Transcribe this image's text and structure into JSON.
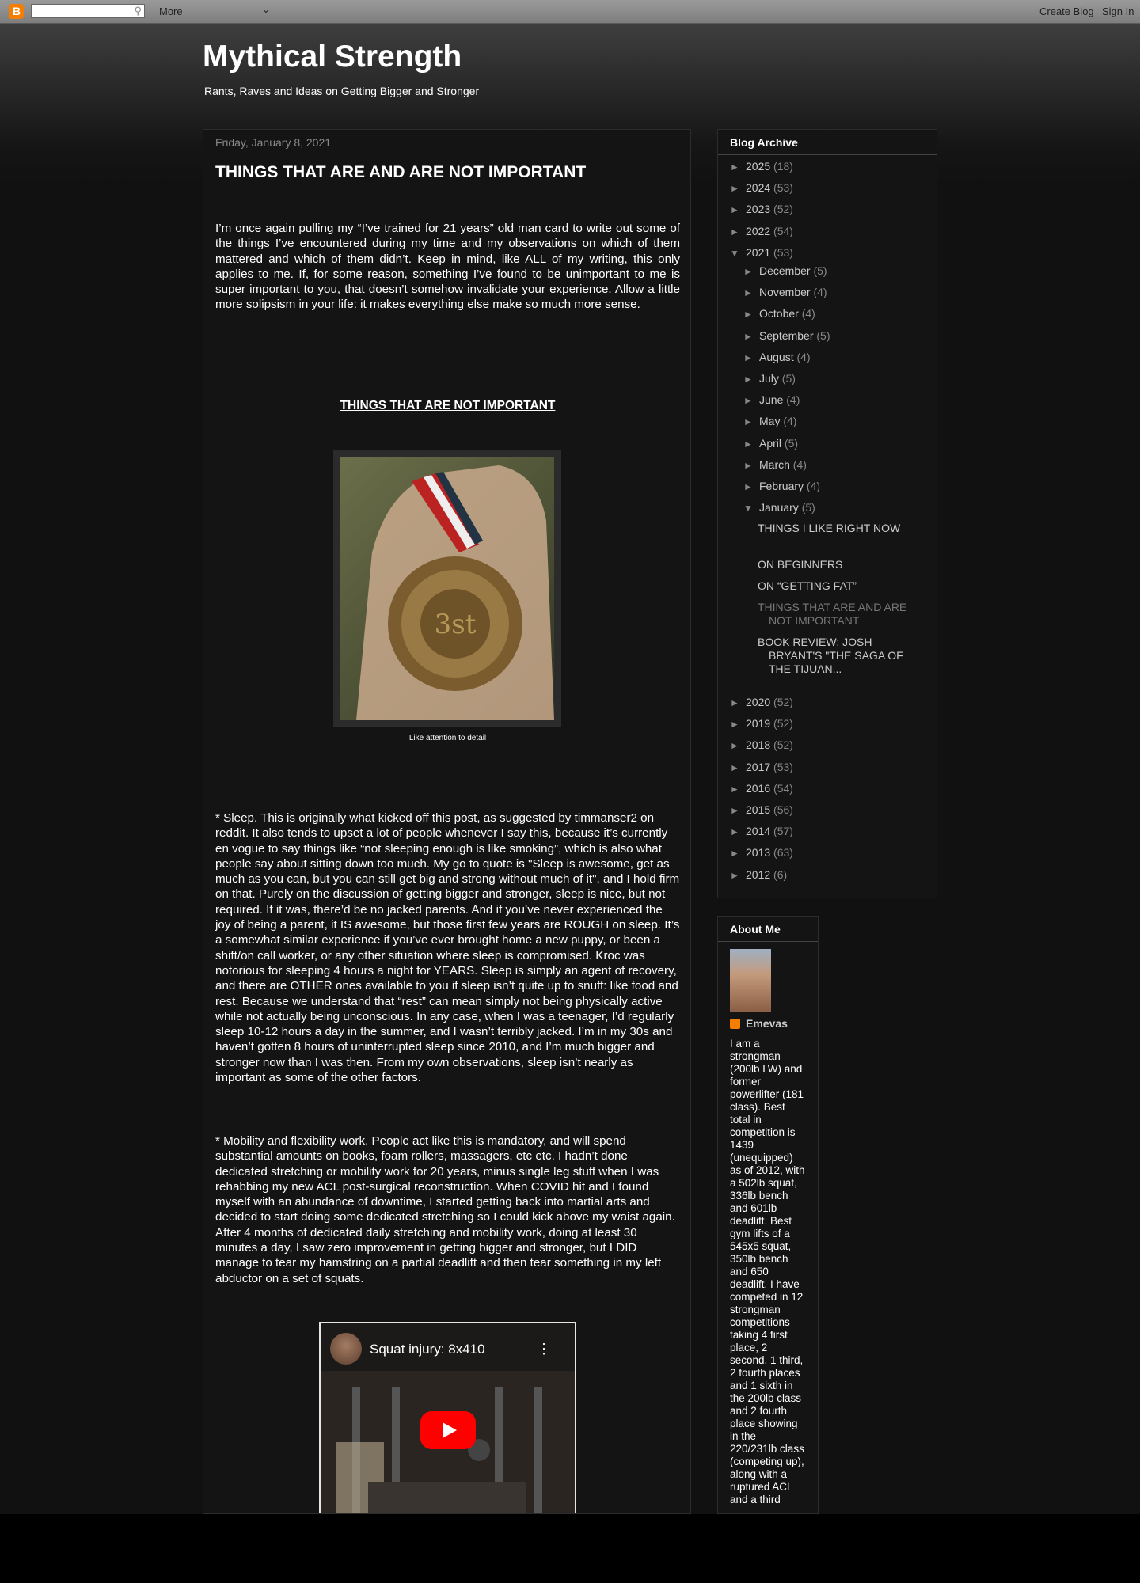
{
  "navbar": {
    "more_label": "More",
    "create_blog": "Create Blog",
    "sign_in": "Sign In"
  },
  "blog": {
    "title": "Mythical Strength",
    "description": "Rants, Raves and Ideas on Getting Bigger and Stronger"
  },
  "post": {
    "date": "Friday, January 8, 2021",
    "title": "THINGS THAT ARE AND ARE NOT IMPORTANT",
    "intro": "I’m once again pulling my “I’ve trained for 21 years” old man card to write out some of the things I’ve encountered during my time and my observations on which of them mattered and which of them didn’t.  Keep in mind, like ALL of my writing, this only applies to me.  If, for some reason, something I’ve found to be unimportant to me is super important to you, that doesn’t somehow invalidate your experience.  Allow a little more solipsism in your life: it makes everything else make so much more sense.",
    "section_heading": "THINGS THAT ARE NOT IMPORTANT",
    "image_caption": "Like attention to detail",
    "sleep": "* Sleep.  This is originally what kicked off this post, as suggested by timmanser2 on reddit.  It also tends to upset a lot of people whenever I say this, because it’s currently en vogue to say things like “not sleeping enough is like smoking”, which is also what people say about sitting down too much.  My go to quote is \"Sleep is awesome, get as much as you can, but you can still get big and strong without much of it\", and I hold firm on that.  Purely on the discussion of getting bigger and stronger, sleep is nice, but not required.  If it was, there’d be no jacked parents.  And if you’ve never experienced the joy of being a parent, it IS awesome, but those first few years are ROUGH on sleep.  It’s a somewhat similar experience if you’ve ever brought home a new puppy, or been a shift/on call worker, or any other situation where sleep is compromised.  Kroc was notorious for sleeping 4 hours a night for YEARS.  Sleep is simply an agent of recovery, and there are OTHER ones available to you if sleep isn’t quite up to snuff: like food and rest.  Because we understand that “rest” can mean simply not being physically active while not actually being unconscious.  In any case, when I was a teenager, I’d regularly sleep 10-12 hours a day in the summer, and I wasn’t terribly jacked.  I’m in my 30s and haven’t gotten 8 hours of uninterrupted sleep since 2010, and I’m much bigger and stronger now than I was then.  From my own observations, sleep isn’t nearly as important as some of the other factors.",
    "mobility": "* Mobility and flexibility work.  People act like this is mandatory, and will spend substantial amounts on books, foam rollers, massagers, etc etc.  I hadn’t done dedicated stretching or mobility work for 20 years, minus single leg stuff when I was rehabbing my new ACL post-surgical reconstruction.  When COVID hit and I found myself with an abundance of downtime, I started getting back into martial arts and decided to start doing some dedicated stretching so I could kick above my waist again.  After 4 months of dedicated daily stretching and mobility work, doing at least 30 minutes a day, I saw zero improvement in getting bigger and stronger, but I DID manage to tear my hamstring on a partial deadlift and then tear something in my left abductor on a set of squats.",
    "video_title": "Squat injury: 8x410"
  },
  "archive": {
    "title": "Blog Archive",
    "years_top": [
      {
        "toggle": "►",
        "year": "2025",
        "count": "(18)"
      },
      {
        "toggle": "►",
        "year": "2024",
        "count": "(53)"
      },
      {
        "toggle": "►",
        "year": "2023",
        "count": "(52)"
      },
      {
        "toggle": "►",
        "year": "2022",
        "count": "(54)"
      },
      {
        "toggle": "▼",
        "year": "2021",
        "count": "(53)"
      }
    ],
    "months": [
      {
        "toggle": "►",
        "month": "December",
        "count": "(5)"
      },
      {
        "toggle": "►",
        "month": "November",
        "count": "(4)"
      },
      {
        "toggle": "►",
        "month": "October",
        "count": "(4)"
      },
      {
        "toggle": "►",
        "month": "September",
        "count": "(5)"
      },
      {
        "toggle": "►",
        "month": "August",
        "count": "(4)"
      },
      {
        "toggle": "►",
        "month": "July",
        "count": "(5)"
      },
      {
        "toggle": "►",
        "month": "June",
        "count": "(4)"
      },
      {
        "toggle": "►",
        "month": "May",
        "count": "(4)"
      },
      {
        "toggle": "►",
        "month": "April",
        "count": "(5)"
      },
      {
        "toggle": "►",
        "month": "March",
        "count": "(4)"
      },
      {
        "toggle": "►",
        "month": "February",
        "count": "(4)"
      },
      {
        "toggle": "▼",
        "month": "January",
        "count": "(5)"
      }
    ],
    "january_posts": [
      "THINGS I LIKE RIGHT NOW",
      "ON BEGINNERS",
      "ON “GETTING FAT”",
      "THINGS THAT ARE AND ARE NOT IMPORTANT",
      "BOOK REVIEW: JOSH BRYANT'S \"THE SAGA OF THE TIJUAN..."
    ],
    "years_bottom": [
      {
        "toggle": "►",
        "year": "2020",
        "count": "(52)"
      },
      {
        "toggle": "►",
        "year": "2019",
        "count": "(52)"
      },
      {
        "toggle": "►",
        "year": "2018",
        "count": "(52)"
      },
      {
        "toggle": "►",
        "year": "2017",
        "count": "(53)"
      },
      {
        "toggle": "►",
        "year": "2016",
        "count": "(54)"
      },
      {
        "toggle": "►",
        "year": "2015",
        "count": "(56)"
      },
      {
        "toggle": "►",
        "year": "2014",
        "count": "(57)"
      },
      {
        "toggle": "►",
        "year": "2013",
        "count": "(63)"
      },
      {
        "toggle": "►",
        "year": "2012",
        "count": "(6)"
      }
    ]
  },
  "about": {
    "title": "About Me",
    "name": "Emevas",
    "bio": "I am a strongman (200lb LW) and former powerlifter (181 class). Best total in competition is 1439 (unequipped) as of 2012, with a 502lb squat, 336lb bench and 601lb deadlift. Best gym lifts of a 545x5 squat, 350lb bench and 650 deadlift. I have competed in 12 strongman competitions taking 4 first place, 2 second, 1 third, 2 fourth places and 1 sixth in the 200lb class and 2 fourth place showing in the 220/231lb class (competing up), along with a ruptured ACL and a third"
  },
  "colors": {
    "accent": "#f57d00",
    "background": "#111111",
    "link": "#cccccc",
    "muted": "#888888"
  }
}
